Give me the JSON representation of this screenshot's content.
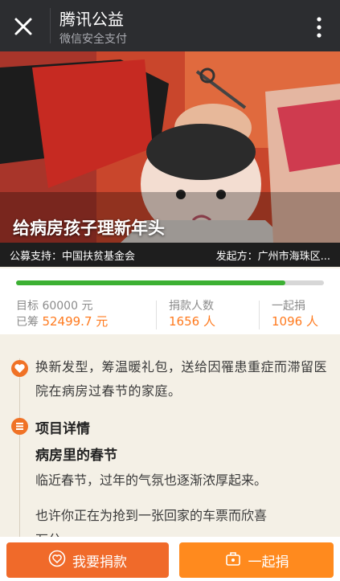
{
  "header": {
    "title": "腾讯公益",
    "subtitle": "微信安全支付"
  },
  "banner": {
    "title": "给病房孩子理新年头",
    "supporter": "公募支持：中国扶贫基金会",
    "initiator": "发起方：广州市海珠区..."
  },
  "stats": {
    "progress": 0.875,
    "target_label": "目标",
    "target_value": "60000 元",
    "raised_label": "已筹",
    "raised_value": "52499.7 元",
    "donors_label": "捐款人数",
    "donors_value": "1656 人",
    "together_label": "一起捐",
    "together_value": "1096 人"
  },
  "description": {
    "summary": "换新发型，筹温暖礼包，送给因罹患重症而滞留医院在病房过春节的家庭。",
    "section_title": "项目详情",
    "subsection_title": "病房里的春节",
    "line1": "临近春节，过年的气氛也逐渐浓厚起来。",
    "line2": "也许你正在为抢到一张回家的车票而欣喜",
    "line3": "万分"
  },
  "buttons": {
    "donate": "我要捐款",
    "together": "一起捐"
  },
  "colors": {
    "accent": "#f07226",
    "progress": "#3cb033",
    "value": "#ff7a1e"
  }
}
